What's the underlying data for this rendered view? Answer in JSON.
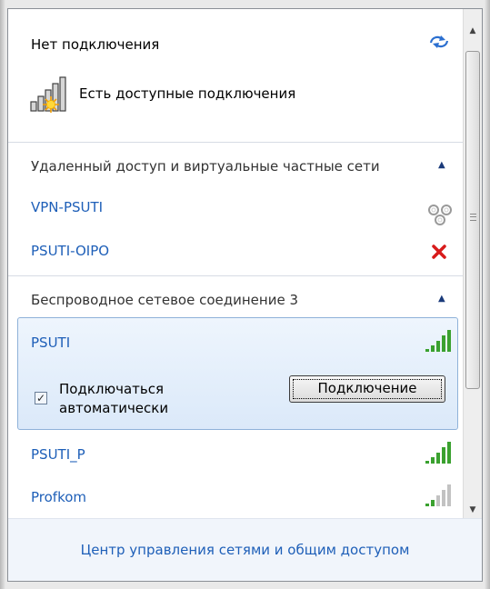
{
  "status": {
    "title": "Нет подключения",
    "available_text": "Есть доступные подключения"
  },
  "vpn_section": {
    "header": "Удаленный доступ и виртуальные частные сети",
    "items": [
      {
        "name": "VPN-PSUTI",
        "icon": "vpn-link-icon"
      },
      {
        "name": "PSUTI-OIPO",
        "icon": "red-x-icon"
      }
    ]
  },
  "wireless_section": {
    "header": "Беспроводное сетевое соединение 3",
    "selected": {
      "name": "PSUTI",
      "auto_connect_label": "Подключаться автоматически",
      "auto_connect_checked": true,
      "connect_button": "Подключение"
    },
    "networks": [
      {
        "name": "PSUTI_P",
        "signal": "strong"
      },
      {
        "name": "Profkom",
        "signal": "weak"
      }
    ]
  },
  "footer": {
    "link": "Центр управления сетями и общим доступом"
  },
  "colors": {
    "link": "#1e5fb8",
    "signal_green": "#3aa12f",
    "error_red": "#d81b1b",
    "selection_bg": "#dbe9f9"
  }
}
